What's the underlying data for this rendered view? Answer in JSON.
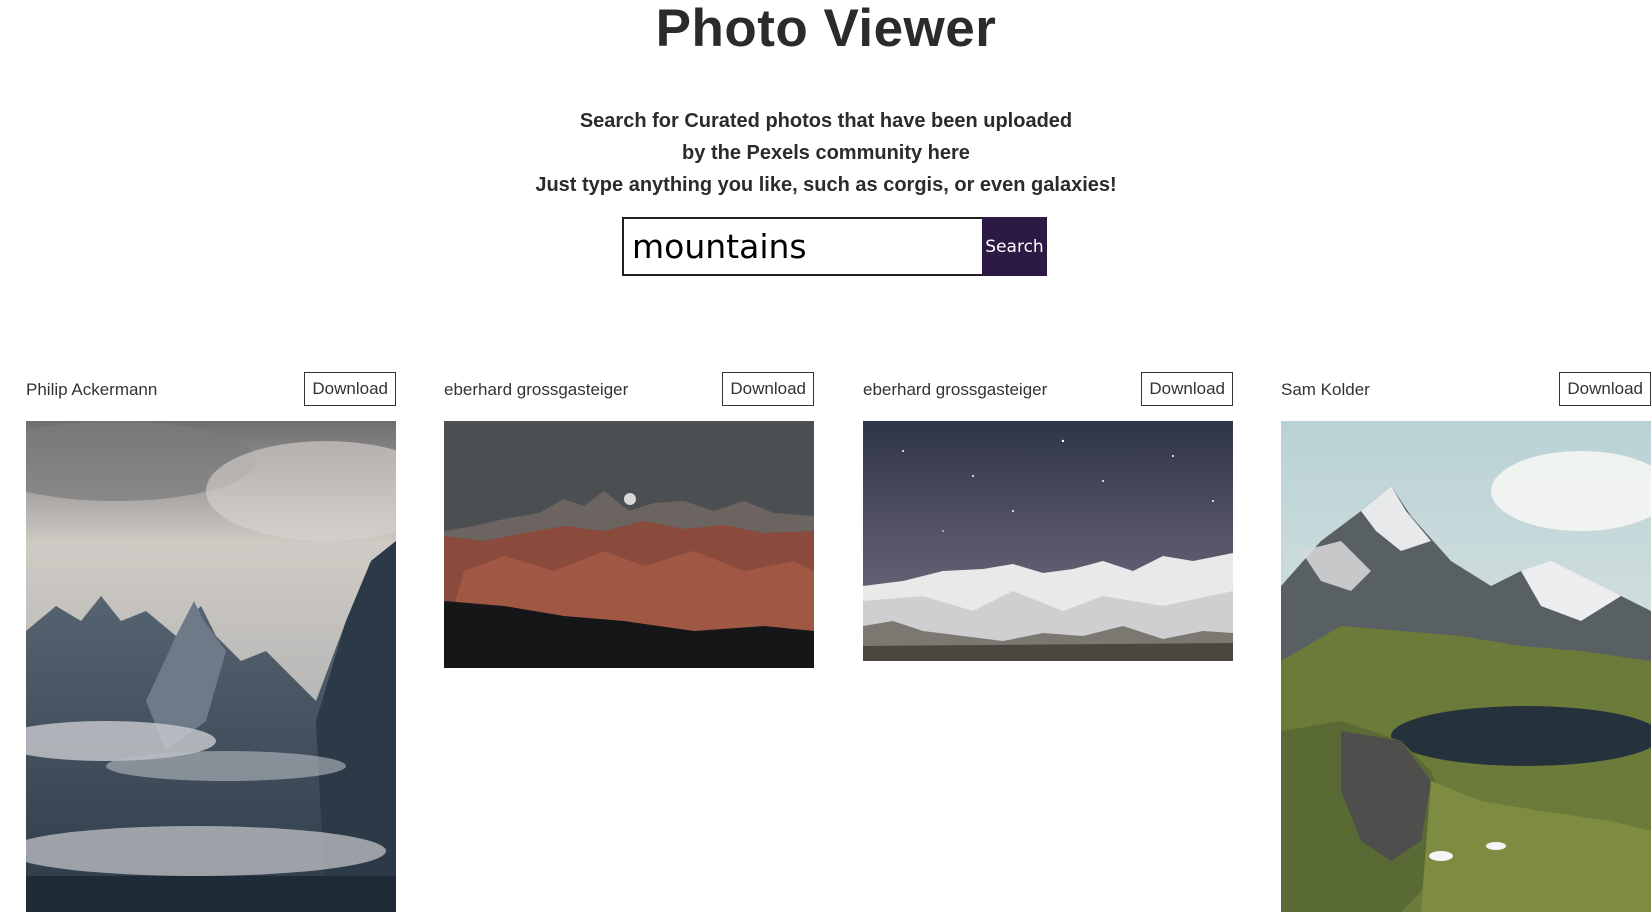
{
  "header": {
    "title": "Photo Viewer",
    "subtitle_lines": [
      "Search for Curated photos that have been uploaded",
      "by the Pexels community here",
      "Just type anything you like, such as corgis, or even galaxies!"
    ]
  },
  "search": {
    "value": "mountains",
    "button_label": "Search"
  },
  "colors": {
    "accent": "#2c1a45",
    "text": "#2b2b2b"
  },
  "photos": [
    {
      "author": "Philip Ackermann",
      "download_label": "Download"
    },
    {
      "author": "eberhard grossgasteiger",
      "download_label": "Download"
    },
    {
      "author": "eberhard grossgasteiger",
      "download_label": "Download"
    },
    {
      "author": "Sam Kolder",
      "download_label": "Download"
    }
  ]
}
